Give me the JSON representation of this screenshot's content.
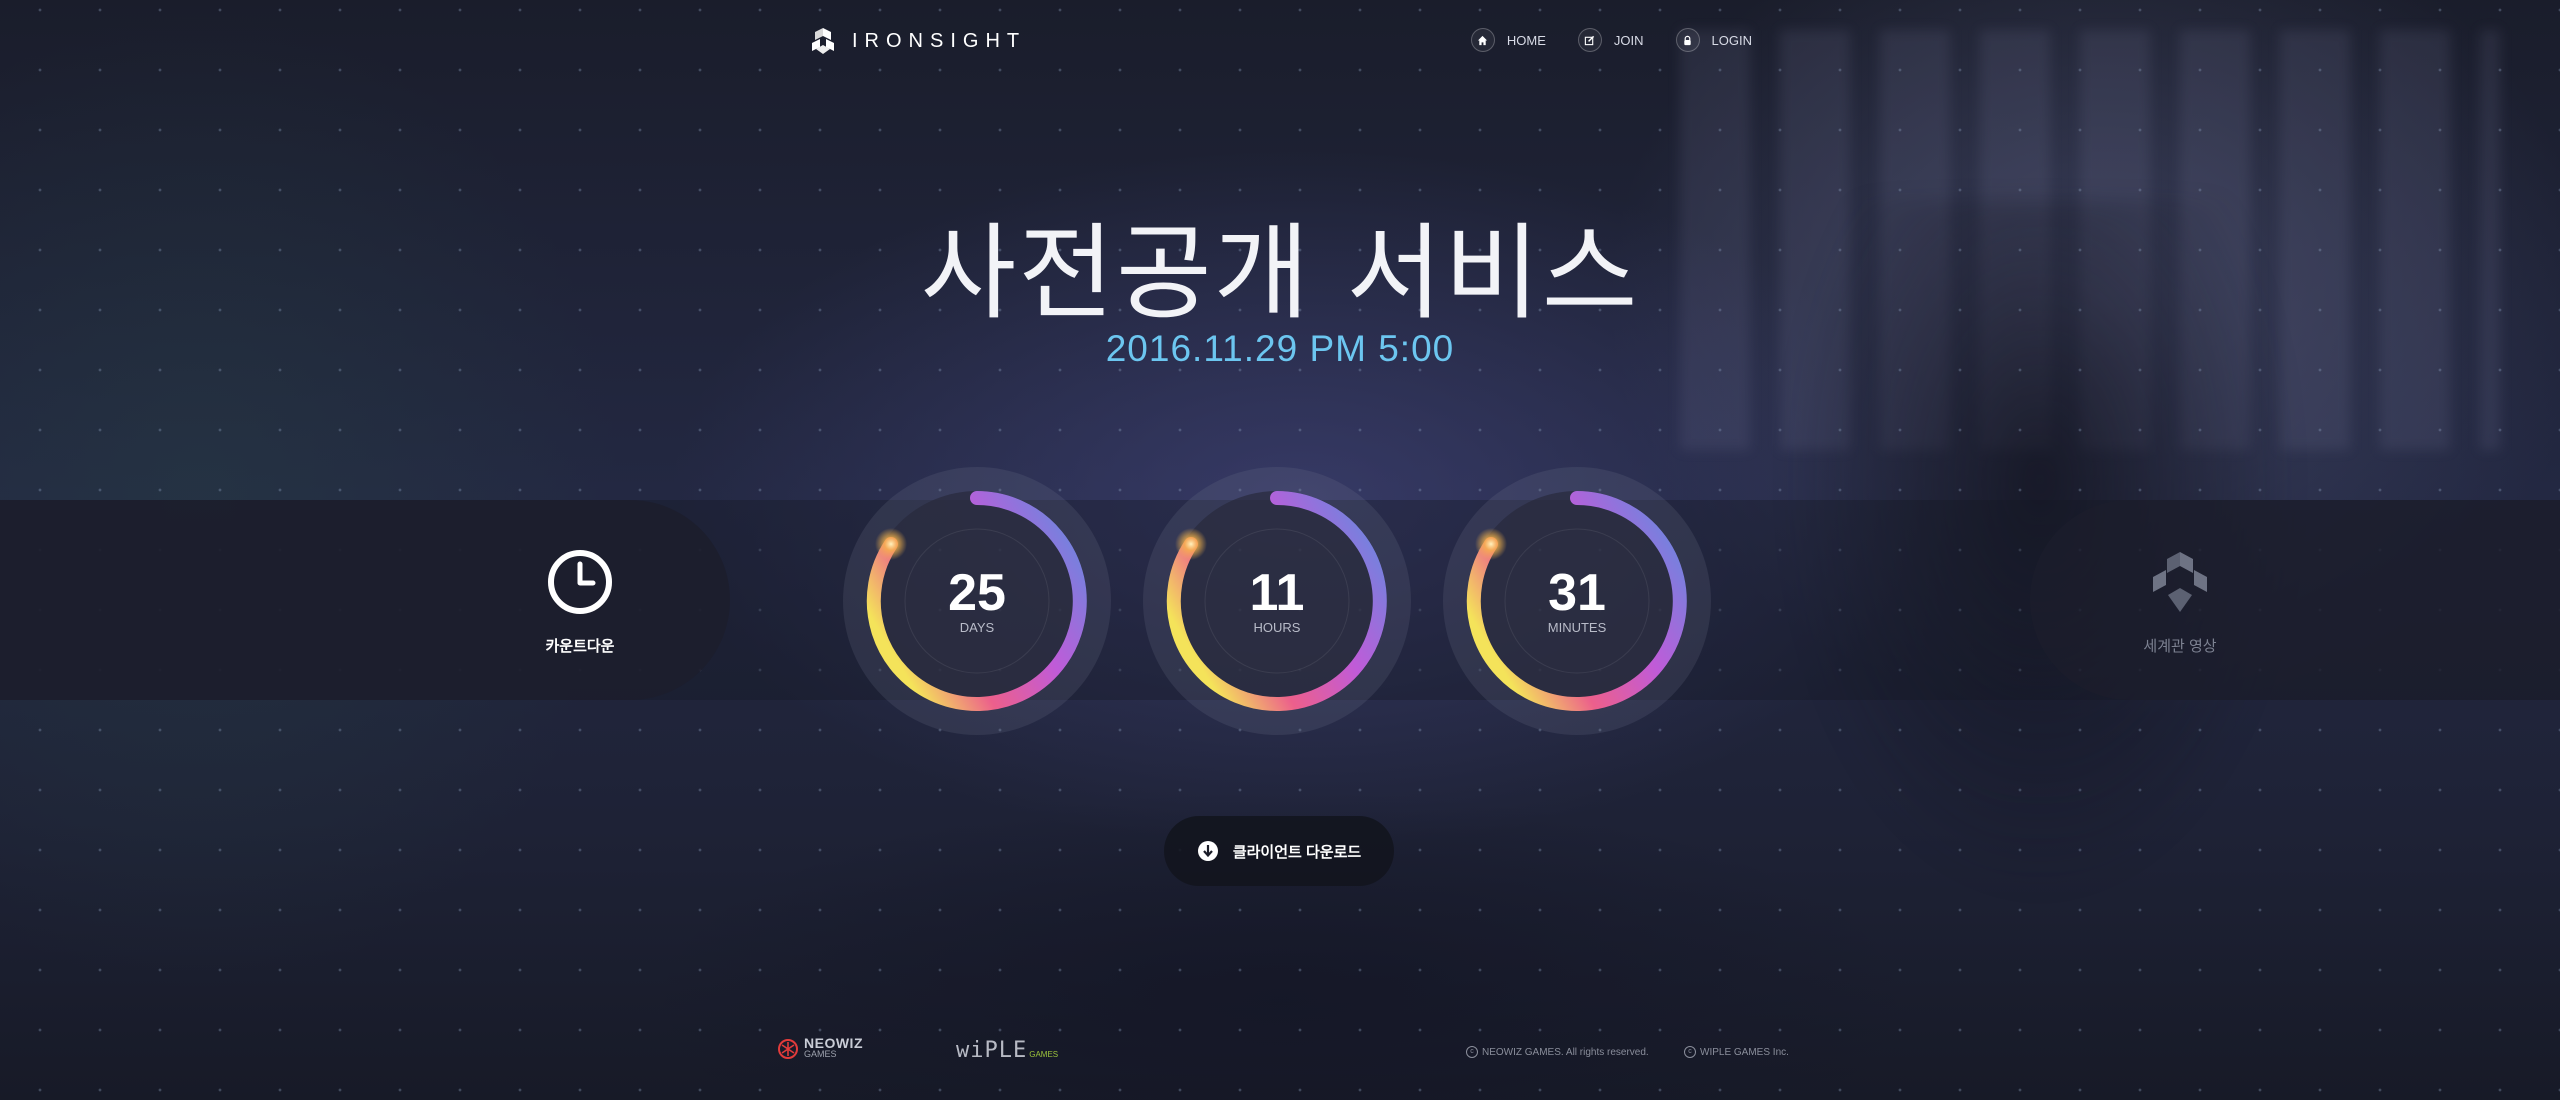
{
  "header": {
    "brand": "IRONSIGHT",
    "nav": [
      {
        "label": "HOME",
        "icon": "home-icon"
      },
      {
        "label": "JOIN",
        "icon": "edit-icon"
      },
      {
        "label": "LOGIN",
        "icon": "lock-icon"
      }
    ]
  },
  "hero": {
    "title": "사전공개 서비스",
    "date": "2016.11.29  PM 5:00"
  },
  "countdown": [
    {
      "value": "25",
      "unit": "DAYS"
    },
    {
      "value": "11",
      "unit": "HOURS"
    },
    {
      "value": "31",
      "unit": "MINUTES"
    }
  ],
  "tabs": {
    "countdown": {
      "label": "카운트다운",
      "icon": "clock-icon"
    },
    "world": {
      "label": "세계관 영상",
      "icon": "ironsight-emblem-icon"
    }
  },
  "download": {
    "label": "클라이언트 다운로드",
    "icon": "download-icon"
  },
  "footer": {
    "neowiz": {
      "name": "NEOWIZ",
      "sub": "GAMES"
    },
    "wiple": {
      "name": "wiPLE",
      "sub": "GAMES"
    },
    "copyright1": "NEOWIZ GAMES. All rights reserved.",
    "copyright2": "WIPLE GAMES Inc."
  },
  "colors": {
    "accent_date": "#6cc6f0",
    "ring_gradient": [
      "#5b8fe0",
      "#c05bd8",
      "#e8608a",
      "#f2e058"
    ]
  }
}
